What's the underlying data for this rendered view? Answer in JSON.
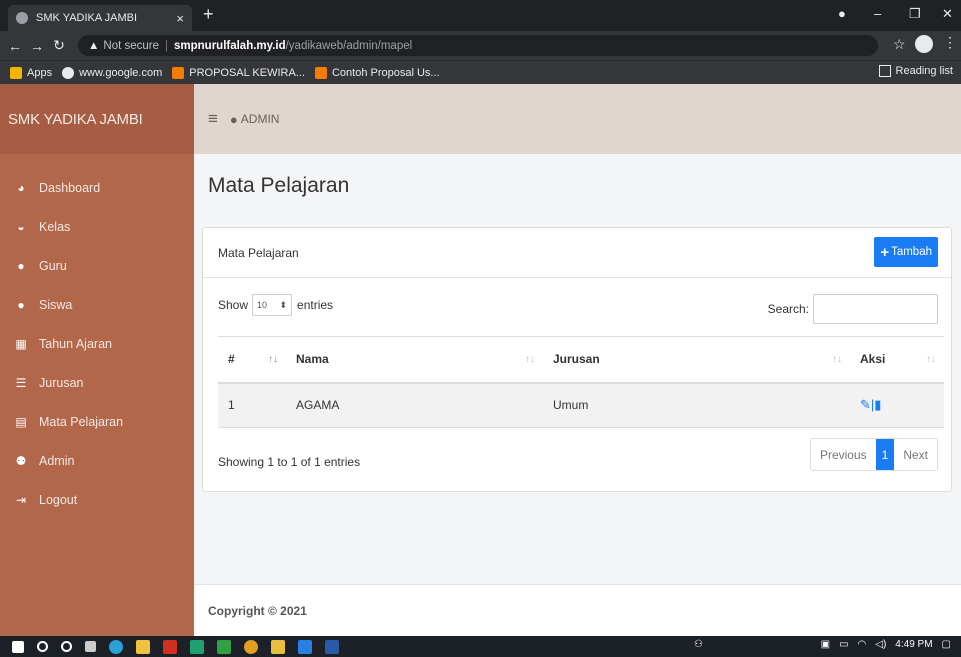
{
  "browser": {
    "tab_title": "SMK YADIKA JAMBI",
    "tab_close": "×",
    "new_tab": "+",
    "security": "Not secure",
    "url_host": "smpnurulfalah.my.id",
    "url_path": "/yadikaweb/admin/mapel",
    "bookmarks": [
      {
        "label": "Apps",
        "color": "#f4b400"
      },
      {
        "label": "www.google.com",
        "color": "#e8eaed"
      },
      {
        "label": "PROPOSAL KEWIRA...",
        "color": "#f57c00"
      },
      {
        "label": "Contoh Proposal Us...",
        "color": "#f57c00"
      }
    ],
    "reading_list": "Reading list"
  },
  "sidebar": {
    "brand": "SMK YADIKA JAMBI",
    "items": [
      {
        "label": "Dashboard",
        "icon": "dashboard-icon",
        "glyph": "◕"
      },
      {
        "label": "Kelas",
        "icon": "inbox-icon",
        "glyph": "◒"
      },
      {
        "label": "Guru",
        "icon": "user-icon",
        "glyph": "●"
      },
      {
        "label": "Siswa",
        "icon": "user-icon",
        "glyph": "●"
      },
      {
        "label": "Tahun Ajaran",
        "icon": "calendar-icon",
        "glyph": "▦"
      },
      {
        "label": "Jurusan",
        "icon": "list-icon",
        "glyph": "☰"
      },
      {
        "label": "Mata Pelajaran",
        "icon": "file-icon",
        "glyph": "▤"
      },
      {
        "label": "Admin",
        "icon": "users-icon",
        "glyph": "⚉"
      },
      {
        "label": "Logout",
        "icon": "sign-out-icon",
        "glyph": "⇥"
      }
    ]
  },
  "topbar": {
    "user_label": "ADMIN"
  },
  "main": {
    "page_title": "Mata Pelajaran",
    "card_title": "Mata Pelajaran",
    "add_button": "Tambah",
    "show_label": "Show",
    "page_length": "10",
    "entries_label": "entries",
    "search_label": "Search:",
    "table": {
      "columns": [
        "#",
        "Nama",
        "Jurusan",
        "Aksi"
      ],
      "rows": [
        {
          "no": "1",
          "nama": "AGAMA",
          "jurusan": "Umum"
        }
      ]
    },
    "info": "Showing 1 to 1 of 1 entries",
    "pager": {
      "previous": "Previous",
      "current": "1",
      "next": "Next"
    }
  },
  "footer": {
    "copyright": "Copyright © 2021"
  },
  "taskbar": {
    "time": "4:49 PM"
  },
  "colors": {
    "sidebar": "#b2664a",
    "topbar": "#e1d6cf",
    "primary": "#1a7cf2"
  }
}
